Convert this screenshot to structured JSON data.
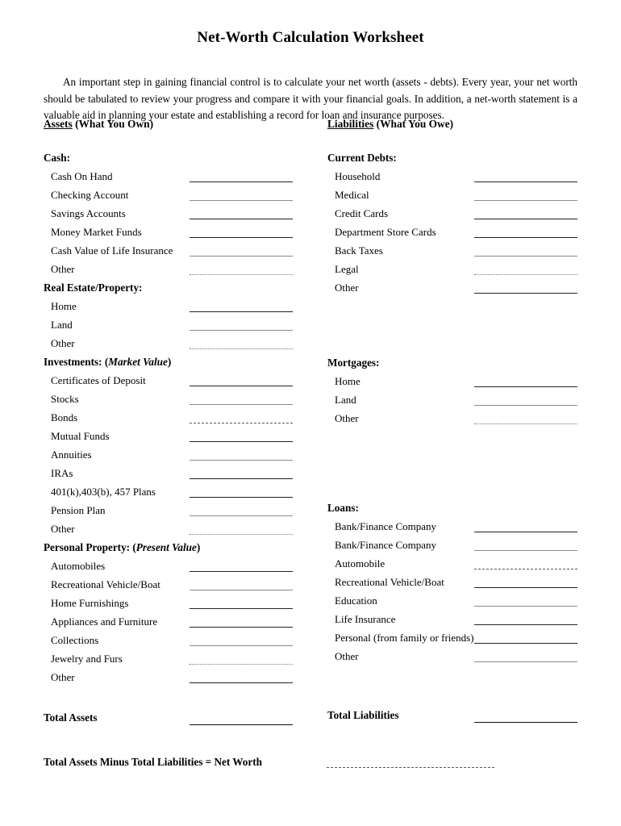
{
  "document": {
    "title": "Net-Worth Calculation Worksheet",
    "intro": "An important step in gaining financial control is to calculate your net worth (assets - debts).  Every year, your net worth should be tabulated to review your progress and compare it with your financial goals.  In addition, a net-worth statement is a valuable aid in planning your estate and establishing a record for loan and insurance purposes."
  },
  "assets": {
    "heading_underlined": "Assets",
    "heading_rest": " (What You Own)",
    "groups": [
      {
        "title": "Cash:",
        "items": [
          "Cash On Hand",
          "Checking Account",
          "Savings Accounts",
          "Money Market Funds",
          "Cash Value of Life Insurance",
          "Other"
        ]
      },
      {
        "title": "Real Estate/Property:",
        "items": [
          "Home",
          "Land",
          "Other"
        ]
      },
      {
        "title": "Investments: ",
        "title_paren_italic": "Market Value",
        "items": [
          "Certificates of Deposit",
          "Stocks",
          "Bonds",
          "Mutual Funds",
          "Annuities",
          "IRAs",
          "401(k),403(b), 457 Plans",
          "Pension Plan",
          "Other"
        ]
      },
      {
        "title": "Personal Property: ",
        "title_paren_italic": "Present Value",
        "items": [
          "Automobiles",
          "Recreational Vehicle/Boat",
          "Home Furnishings",
          "Appliances and Furniture",
          "Collections",
          "Jewelry and Furs",
          "Other"
        ]
      }
    ]
  },
  "liabilities": {
    "heading_underlined": "Liabilities",
    "heading_rest": " (What You Owe)",
    "groups": [
      {
        "title": "Current Debts:",
        "items": [
          "Household",
          "Medical",
          "Credit Cards",
          "Department Store Cards",
          "Back Taxes",
          "Legal",
          "Other"
        ]
      },
      {
        "title": "Mortgages:",
        "items": [
          "Home",
          "Land",
          "Other"
        ]
      },
      {
        "title": "Loans:",
        "items": [
          "Bank/Finance Company",
          "Bank/Finance Company",
          "Automobile",
          "Recreational Vehicle/Boat",
          "Education",
          "Life Insurance",
          "Personal (from family or friends)",
          "Other"
        ]
      }
    ]
  },
  "totals": {
    "total_assets": "Total Assets",
    "total_liabilities": "Total Liabilities",
    "net_worth": "Total Assets Minus Total Liabilities = Net Worth"
  }
}
